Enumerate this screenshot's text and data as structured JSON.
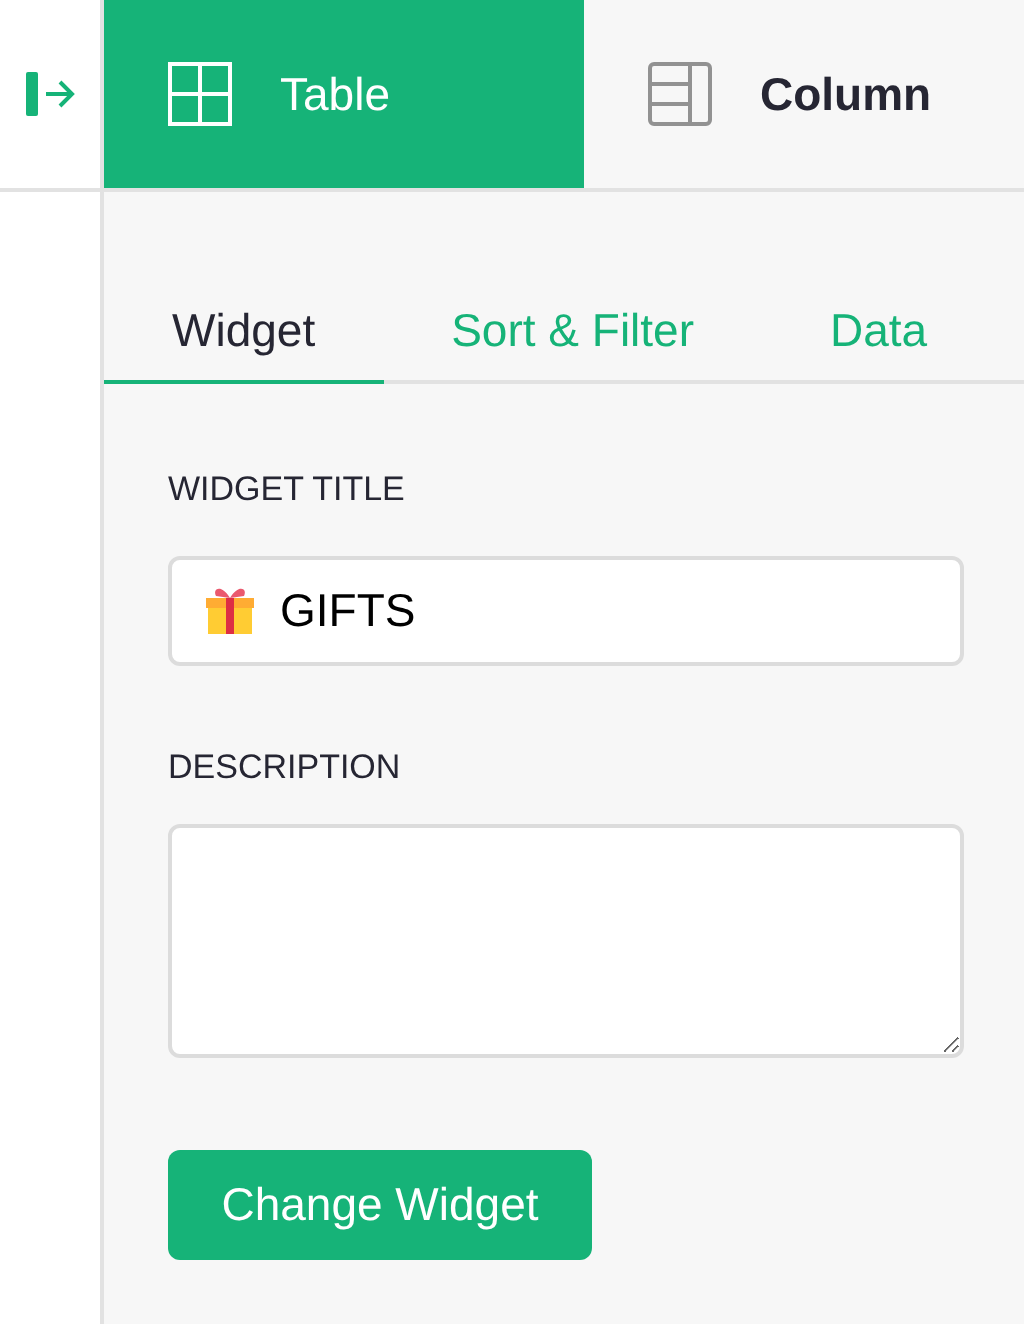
{
  "top_tabs": [
    {
      "label": "Table",
      "kind": "table",
      "selected": true
    },
    {
      "label": "Column",
      "kind": "column",
      "selected": false
    }
  ],
  "sub_tabs": [
    {
      "label": "Widget",
      "selected": true
    },
    {
      "label": "Sort & Filter",
      "selected": false
    },
    {
      "label": "Data",
      "selected": false
    }
  ],
  "widget_title": {
    "label": "WIDGET TITLE",
    "value": "GIFTS"
  },
  "description": {
    "label": "DESCRIPTION"
  },
  "button": "Change Widget"
}
